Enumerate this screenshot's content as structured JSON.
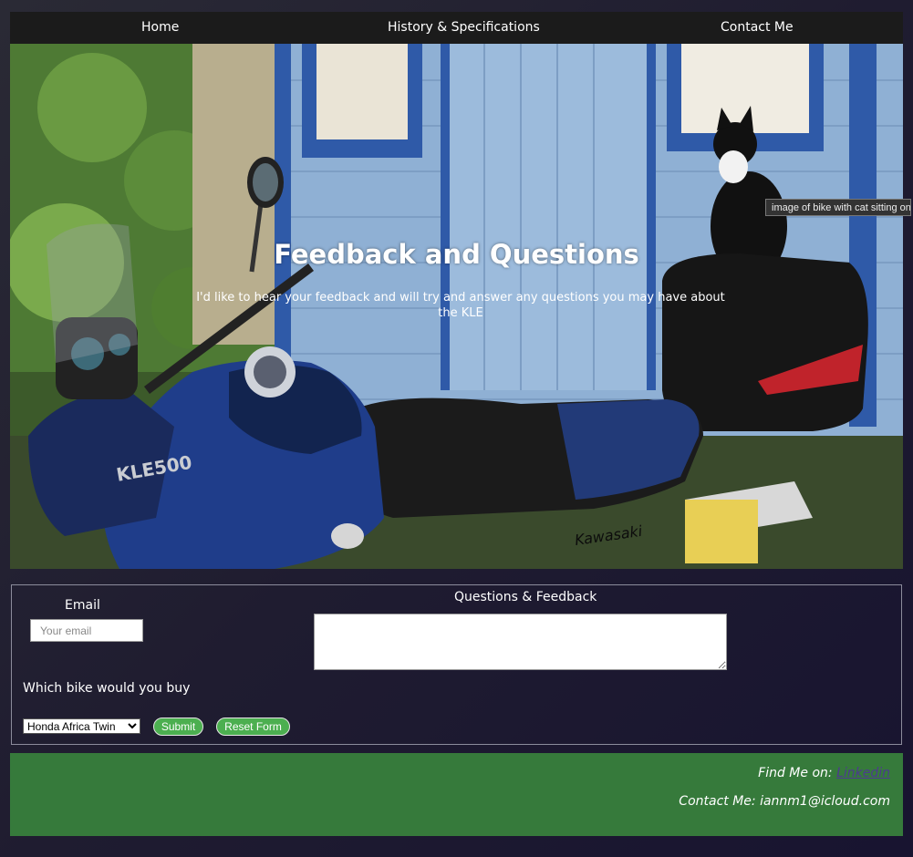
{
  "nav": {
    "items": [
      {
        "label": "Home"
      },
      {
        "label": "History & Specifications"
      },
      {
        "label": "Contact Me"
      }
    ]
  },
  "hero": {
    "title": "Feedback and Questions",
    "subtitle": "I'd like to hear your feedback and will try and answer any questions you may have about the KLE",
    "image_tooltip": "image of bike with cat sitting on it",
    "bike_badge": "KLE500",
    "tank_brand": "Kawasaki"
  },
  "form": {
    "email_label": "Email",
    "email_placeholder": "Your email",
    "feedback_label": "Questions & Feedback",
    "bike_question": "Which bike would you buy",
    "bike_selected": "Honda Africa Twin",
    "submit_label": "Submit",
    "reset_label": "Reset Form"
  },
  "footer": {
    "find_me_prefix": "Find Me on: ",
    "find_me_link": "Linkedin",
    "contact_line": "Contact Me: iannm1@icloud.com"
  },
  "colors": {
    "nav_bg": "#1b1b1b",
    "footer_bg": "#367a3b",
    "button_green": "#4caf50",
    "link": "#4d3a8f"
  }
}
